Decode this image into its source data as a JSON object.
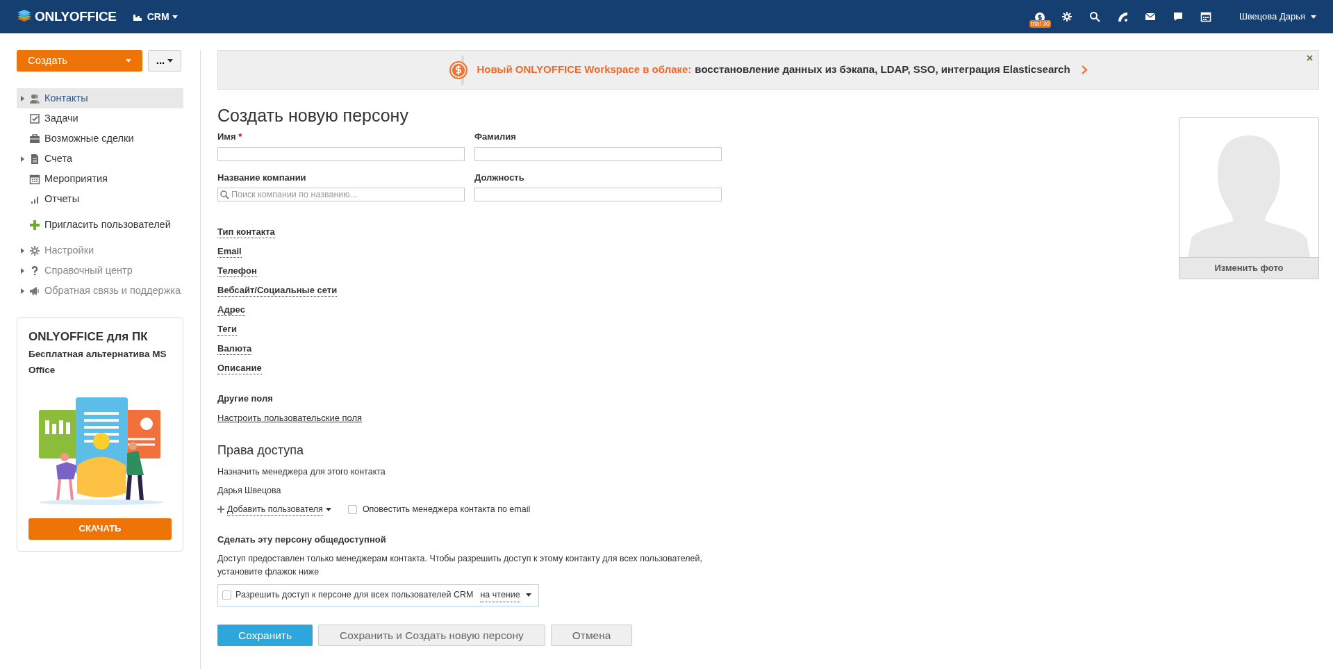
{
  "topbar": {
    "logo": "ONLYOFFICE",
    "module": "CRM",
    "trial_badge": "trial 30",
    "user": "Швецова Дарья"
  },
  "sidebar": {
    "create_button": "Создать",
    "more_button": "...",
    "items": [
      {
        "label": "Контакты",
        "expandable": true,
        "selected": true,
        "dimmed": false
      },
      {
        "label": "Задачи",
        "expandable": false,
        "selected": false,
        "dimmed": false
      },
      {
        "label": "Возможные сделки",
        "expandable": false,
        "selected": false,
        "dimmed": false
      },
      {
        "label": "Счета",
        "expandable": true,
        "selected": false,
        "dimmed": false
      },
      {
        "label": "Мероприятия",
        "expandable": false,
        "selected": false,
        "dimmed": false
      },
      {
        "label": "Отчеты",
        "expandable": false,
        "selected": false,
        "dimmed": false
      }
    ],
    "invite": "Пригласить пользователей",
    "extra_items": [
      {
        "label": "Настройки",
        "expandable": true,
        "selected": false,
        "dimmed": true
      },
      {
        "label": "Справочный центр",
        "expandable": true,
        "selected": false,
        "dimmed": true
      },
      {
        "label": "Обратная связь и поддержка",
        "expandable": true,
        "selected": false,
        "dimmed": true
      }
    ],
    "promo": {
      "title": "ONLYOFFICE для ПК",
      "subtitle": "Бесплатная альтернатива MS Office",
      "button": "СКАЧАТЬ"
    }
  },
  "banner": {
    "highlight": "Новый ONLYOFFICE Workspace в облаке:",
    "text": "восстановление данных из бэкапа, LDAP, SSO, интеграция Elasticsearch"
  },
  "form": {
    "title": "Создать новую персону",
    "required_mark": "*",
    "fields": [
      {
        "label": "Имя",
        "required": true,
        "kind": "text"
      },
      {
        "label": "Фамилия",
        "required": false,
        "kind": "text"
      },
      {
        "label": "Название компании",
        "required": false,
        "kind": "search",
        "placeholder": "Поиск компании по названию..."
      },
      {
        "label": "Должность",
        "required": false,
        "kind": "text"
      }
    ],
    "sections": [
      "Тип контакта",
      "Email",
      "Телефон",
      "Вебсайт/Социальные сети",
      "Адрес",
      "Теги",
      "Валюта",
      "Описание"
    ],
    "other_fields": {
      "heading": "Другие поля",
      "link": "Настроить пользовательские поля"
    },
    "photo": {
      "button": "Изменить фото"
    }
  },
  "access": {
    "heading": "Права доступа",
    "assign_label": "Назначить менеджера для этого контакта",
    "manager": "Дарья Швецова",
    "add_user": "Добавить пользователя",
    "notify": {
      "label": "Оповестить менеджера контакта по email",
      "checked": false
    },
    "public_heading": "Сделать эту персону общедоступной",
    "public_note": "Доступ предоставлен только менеджерам контакта. Чтобы разрешить доступ к этому контакту для всех пользователей, установите флажок ниже",
    "share": {
      "label": "Разрешить доступ к персоне для всех пользователей CRM",
      "checked": false,
      "mode": "на чтение"
    }
  },
  "buttons": [
    {
      "label": "Сохранить",
      "kind": "primary"
    },
    {
      "label": "Сохранить и Создать новую персону",
      "kind": "secondary"
    },
    {
      "label": "Отмена",
      "kind": "secondary"
    }
  ]
}
